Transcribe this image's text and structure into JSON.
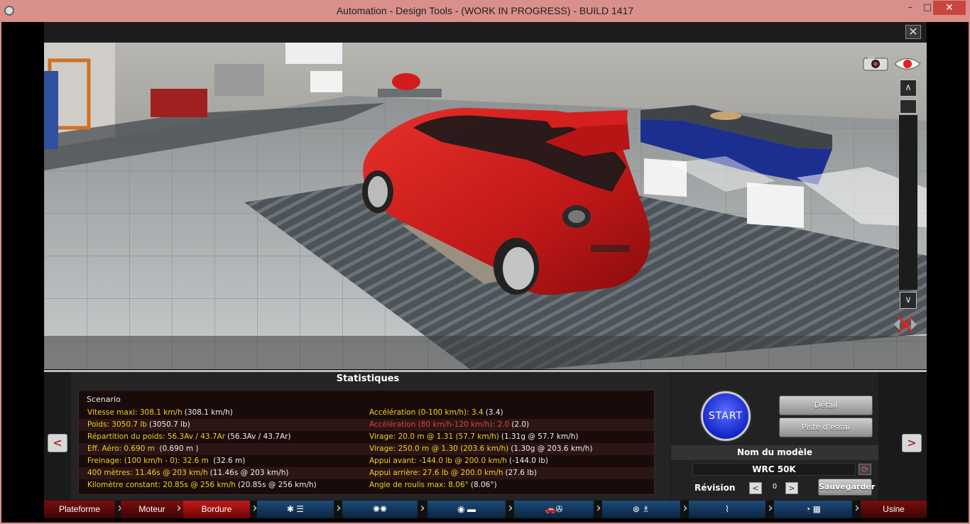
{
  "window": {
    "title": "Automation - Design Tools - (WORK IN PROGRESS) - BUILD 1417",
    "minimize": "–",
    "maximize": "□",
    "close": "✕"
  },
  "app": {
    "close_label": "✕"
  },
  "viewport": {
    "scroll_up": "∧",
    "scroll_down": "∨",
    "icons": [
      "camera-icon",
      "eye-icon",
      "axis-toggle-icon"
    ]
  },
  "stats": {
    "title": "Statistiques",
    "scenario": "Scenario",
    "rows": [
      {
        "left_key": "Vitesse maxi: 308.1 km/h",
        "left_paren": "(308.1 km/h)",
        "right_key": "Accélération (0-100 km/h): 3.4",
        "right_paren": "(3.4)"
      },
      {
        "left_key": "Poids: 3050.7 lb",
        "left_paren": "(3050.7 lb)",
        "right_key": "Accélération (80 km/h-120 km/h): 2.0",
        "right_paren": "(2.0)"
      },
      {
        "left_key": "Répartition du poids: 56.3Av / 43.7Ar",
        "left_paren": "(56.3Av / 43.7Ar)",
        "right_key": "Virage: 20.0 m @ 1.31 (57.7 km/h)",
        "right_paren": "(1.31g @ 57.7 km/h)"
      },
      {
        "left_key": "Eff. Aéro: 0.690 m",
        "left_paren": " (0.690 m )",
        "right_key": "Virage: 250.0 m @ 1.30 (203.6 km/h)",
        "right_paren": "(1.30g @ 203.6 km/h)"
      },
      {
        "left_key": "Freinage: (100 km/h - 0): 32.6 m",
        "left_paren": " (32.6 m)",
        "right_key": "Appui avant: -144.0 lb @ 200.0 km/h",
        "right_paren": "(-144.0 lb)"
      },
      {
        "left_key": "400 mètres: 11.46s @ 203 km/h",
        "left_paren": "(11.46s @ 203 km/h)",
        "right_key": "Appui arrière: 27.6 lb @ 200.0 km/h",
        "right_paren": "(27.6 lb)"
      },
      {
        "left_key": "Kilomètre constant: 20.85s @ 256 km/h",
        "left_paren": "(20.85s @ 256 km/h)",
        "right_key": "Angle de roulis max: 8.06°",
        "right_paren": "(8.06°)"
      }
    ],
    "highlight_red_row": 1
  },
  "nav": {
    "prev": "<",
    "next": ">"
  },
  "controls": {
    "start": "START",
    "detail": "Détail",
    "test_track": "Piste d'essai",
    "model_header": "Nom du modèle",
    "model_name": "WRC 50K",
    "revision_label": "Révision",
    "revision_value": "0",
    "rev_prev": "<",
    "rev_next": ">",
    "save": "Sauvegarder"
  },
  "tabs": [
    {
      "label": "Plateforme",
      "style": "red"
    },
    {
      "label": "Moteur",
      "style": "red"
    },
    {
      "label": "Bordure",
      "style": "active"
    },
    {
      "label": "",
      "icon": "engine-gearbox-icon",
      "style": "blue"
    },
    {
      "label": "",
      "icon": "wheels-icon",
      "style": "blue"
    },
    {
      "label": "",
      "icon": "tyre-body-icon",
      "style": "blue"
    },
    {
      "label": "",
      "icon": "car-fan-icon",
      "style": "blue"
    },
    {
      "label": "",
      "icon": "steering-seat-icon",
      "style": "blue"
    },
    {
      "label": "",
      "icon": "suspension-icon",
      "style": "blue"
    },
    {
      "label": "",
      "icon": "gauge-flag-icon",
      "style": "blue"
    },
    {
      "label": "Usine",
      "style": "red"
    }
  ]
}
